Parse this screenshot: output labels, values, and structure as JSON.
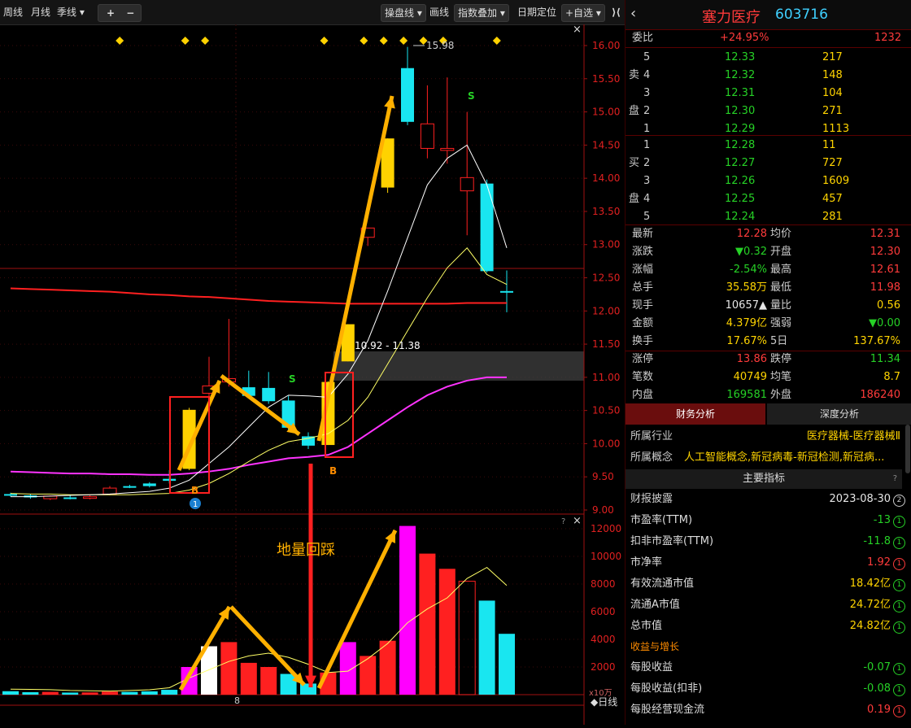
{
  "toolbar": {
    "week": "周线",
    "month": "月线",
    "season": "季线 ▾",
    "plus": "+",
    "minus": "−",
    "mode": "操盘线 ▾",
    "draw": "画线",
    "indicator": "指数叠加 ▾",
    "datepos": "日期定位",
    "watch": "+自选 ▾",
    "collapse": "⟩⟨"
  },
  "stock": {
    "name": "塞力医疗",
    "code": "603716"
  },
  "weibi": {
    "label": "委比",
    "pct": "+24.95%",
    "diff": "1232"
  },
  "sell_label": [
    "卖",
    "盘"
  ],
  "buy_label": [
    "买",
    "盘"
  ],
  "sell": [
    {
      "lvl": "5",
      "price": "12.33",
      "vol": "217"
    },
    {
      "lvl": "4",
      "price": "12.32",
      "vol": "148"
    },
    {
      "lvl": "3",
      "price": "12.31",
      "vol": "104"
    },
    {
      "lvl": "2",
      "price": "12.30",
      "vol": "271"
    },
    {
      "lvl": "1",
      "price": "12.29",
      "vol": "1113"
    }
  ],
  "buy": [
    {
      "lvl": "1",
      "price": "12.28",
      "vol": "11"
    },
    {
      "lvl": "2",
      "price": "12.27",
      "vol": "727"
    },
    {
      "lvl": "3",
      "price": "12.26",
      "vol": "1609"
    },
    {
      "lvl": "4",
      "price": "12.25",
      "vol": "457"
    },
    {
      "lvl": "5",
      "price": "12.24",
      "vol": "281"
    }
  ],
  "quote": [
    {
      "l1": "最新",
      "v1": "12.28",
      "c1": "red",
      "l2": "均价",
      "v2": "12.31",
      "c2": "red"
    },
    {
      "l1": "涨跌",
      "v1": "▼0.32",
      "c1": "grn",
      "l2": "开盘",
      "v2": "12.30",
      "c2": "red"
    },
    {
      "l1": "涨幅",
      "v1": "-2.54%",
      "c1": "grn",
      "l2": "最高",
      "v2": "12.61",
      "c2": "red"
    },
    {
      "l1": "总手",
      "v1": "35.58万",
      "c1": "yel",
      "l2": "最低",
      "v2": "11.98",
      "c2": "red"
    },
    {
      "l1": "现手",
      "v1": "10657▲",
      "c1": "wht",
      "l2": "量比",
      "v2": "0.56",
      "c2": "yel"
    },
    {
      "l1": "金额",
      "v1": "4.379亿",
      "c1": "yel",
      "l2": "强弱",
      "v2": "▼0.00",
      "c2": "grn"
    },
    {
      "l1": "换手",
      "v1": "17.67%",
      "c1": "yel",
      "l2": "5日",
      "v2": "137.67%",
      "c2": "yel"
    },
    {
      "l1": "涨停",
      "v1": "13.86",
      "c1": "red",
      "l2": "跌停",
      "v2": "11.34",
      "c2": "grn"
    },
    {
      "l1": "笔数",
      "v1": "40749",
      "c1": "yel",
      "l2": "均笔",
      "v2": "8.7",
      "c2": "yel"
    },
    {
      "l1": "内盘",
      "v1": "169581",
      "c1": "grn",
      "l2": "外盘",
      "v2": "186240",
      "c2": "red"
    }
  ],
  "tabs": {
    "finance": "财务分析",
    "depth": "深度分析"
  },
  "industry": {
    "label": "所属行业",
    "value": "医疗器械-医疗器械Ⅱ"
  },
  "concept": {
    "label": "所属概念",
    "value": "人工智能概念,新冠病毒-新冠检测,新冠病..."
  },
  "main_title": "主要指标",
  "help": "?",
  "report": {
    "label": "财报披露",
    "value": "2023-08-30",
    "badge": "2"
  },
  "indicators": [
    {
      "label": "市盈率(TTM)",
      "value": "-13",
      "color": "grn",
      "badge": "1"
    },
    {
      "label": "扣非市盈率(TTM)",
      "value": "-11.8",
      "color": "grn",
      "badge": "1"
    },
    {
      "label": "市净率",
      "value": "1.92",
      "color": "red",
      "badge": "1"
    },
    {
      "label": "有效流通市值",
      "value": "18.42亿",
      "color": "yel",
      "badge": "1"
    },
    {
      "label": "流通A市值",
      "value": "24.72亿",
      "color": "yel",
      "badge": "1"
    },
    {
      "label": "总市值",
      "value": "24.82亿",
      "color": "yel",
      "badge": "1"
    }
  ],
  "growth_title": "收益与增长",
  "growth": [
    {
      "label": "每股收益",
      "value": "-0.07",
      "color": "grn",
      "badge": "1"
    },
    {
      "label": "每股收益(扣非)",
      "value": "-0.08",
      "color": "grn",
      "badge": "1"
    },
    {
      "label": "每股经营现金流",
      "value": "0.19",
      "color": "red",
      "badge": "1"
    }
  ],
  "chart_labels": {
    "high": "15.98",
    "range": "10.92 - 11.38",
    "annotation": "地量回踩",
    "date": "8",
    "period": "◆日线",
    "unit": "x10万",
    "sig_s": "S",
    "sig_b": "B",
    "badge1": "1",
    "close_x": "×",
    "question": "?"
  },
  "colors": {
    "up": "#ff2020",
    "down": "#19e6f0",
    "yellow": "#ffd200",
    "magenta": "#ff00ff",
    "arrow": "#ffb000"
  },
  "chart_data": {
    "type": "candlestick",
    "price_ticks": [
      16.0,
      15.5,
      15.0,
      14.5,
      14.0,
      13.5,
      13.0,
      12.5,
      12.0,
      11.5,
      11.0,
      10.5,
      10.0,
      9.5,
      9.0
    ],
    "volume_ticks": [
      12000,
      10000,
      8000,
      6000,
      4000,
      2000
    ],
    "candles": [
      {
        "o": 9.24,
        "h": 9.26,
        "l": 9.2,
        "c": 9.22,
        "col": "down"
      },
      {
        "o": 9.22,
        "h": 9.24,
        "l": 9.17,
        "c": 9.19,
        "col": "down"
      },
      {
        "o": 9.17,
        "h": 9.22,
        "l": 9.15,
        "c": 9.21,
        "col": "up"
      },
      {
        "o": 9.19,
        "h": 9.22,
        "l": 9.16,
        "c": 9.18,
        "col": "down"
      },
      {
        "o": 9.18,
        "h": 9.22,
        "l": 9.16,
        "c": 9.2,
        "col": "up"
      },
      {
        "o": 9.24,
        "h": 9.36,
        "l": 9.22,
        "c": 9.33,
        "col": "up"
      },
      {
        "o": 9.35,
        "h": 9.38,
        "l": 9.33,
        "c": 9.36,
        "col": "down"
      },
      {
        "o": 9.4,
        "h": 9.42,
        "l": 9.34,
        "c": 9.36,
        "col": "down"
      },
      {
        "o": 9.47,
        "h": 9.6,
        "l": 9.4,
        "c": 9.44,
        "col": "down"
      },
      {
        "o": 9.62,
        "h": 10.54,
        "l": 9.6,
        "c": 10.51,
        "col": "yel"
      },
      {
        "o": 10.76,
        "h": 11.31,
        "l": 10.62,
        "c": 10.87,
        "col": "up"
      },
      {
        "o": 10.93,
        "h": 11.88,
        "l": 10.86,
        "c": 10.98,
        "col": "up"
      },
      {
        "o": 10.85,
        "h": 11.1,
        "l": 10.7,
        "c": 10.72,
        "col": "down"
      },
      {
        "o": 10.84,
        "h": 11.08,
        "l": 10.6,
        "c": 10.64,
        "col": "down"
      },
      {
        "o": 10.65,
        "h": 10.72,
        "l": 10.2,
        "c": 10.24,
        "col": "down"
      },
      {
        "o": 10.11,
        "h": 10.17,
        "l": 9.92,
        "c": 9.97,
        "col": "down"
      },
      {
        "o": 9.98,
        "h": 10.94,
        "l": 9.98,
        "c": 10.93,
        "col": "yel"
      },
      {
        "o": 11.24,
        "h": 11.8,
        "l": 11.24,
        "c": 11.8,
        "col": "yel"
      },
      {
        "o": 13.25,
        "h": 13.25,
        "l": 12.98,
        "c": 13.11,
        "col": "up"
      },
      {
        "o": 13.86,
        "h": 14.6,
        "l": 13.78,
        "c": 14.6,
        "col": "yel"
      },
      {
        "o": 14.85,
        "h": 15.98,
        "l": 14.8,
        "c": 15.66,
        "col": "down"
      },
      {
        "o": 14.82,
        "h": 15.4,
        "l": 14.3,
        "c": 14.45,
        "col": "up"
      },
      {
        "o": 14.45,
        "h": 15.52,
        "l": 14.22,
        "c": 14.42,
        "col": "up"
      },
      {
        "o": 14.01,
        "h": 15.0,
        "l": 13.14,
        "c": 13.81,
        "col": "up"
      },
      {
        "o": 13.92,
        "h": 13.98,
        "l": 12.58,
        "c": 12.6,
        "col": "down"
      },
      {
        "o": 12.3,
        "h": 12.61,
        "l": 11.98,
        "c": 12.28,
        "col": "down"
      }
    ],
    "volumes": [
      {
        "v": 250,
        "col": "down"
      },
      {
        "v": 180,
        "col": "down"
      },
      {
        "v": 200,
        "col": "up"
      },
      {
        "v": 150,
        "col": "down"
      },
      {
        "v": 160,
        "col": "up"
      },
      {
        "v": 220,
        "col": "up"
      },
      {
        "v": 200,
        "col": "down"
      },
      {
        "v": 240,
        "col": "down"
      },
      {
        "v": 350,
        "col": "down"
      },
      {
        "v": 2000,
        "col": "magenta"
      },
      {
        "v": 3500,
        "col": "white"
      },
      {
        "v": 3800,
        "col": "up"
      },
      {
        "v": 2300,
        "col": "up"
      },
      {
        "v": 2000,
        "col": "up"
      },
      {
        "v": 1500,
        "col": "down"
      },
      {
        "v": 800,
        "col": "down"
      },
      {
        "v": 1600,
        "col": "up"
      },
      {
        "v": 3800,
        "col": "magenta"
      },
      {
        "v": 2800,
        "col": "up"
      },
      {
        "v": 3900,
        "col": "up"
      },
      {
        "v": 12200,
        "col": "magenta"
      },
      {
        "v": 10200,
        "col": "up"
      },
      {
        "v": 9100,
        "col": "up"
      },
      {
        "v": 8200,
        "col": "hollow"
      },
      {
        "v": 6800,
        "col": "down"
      },
      {
        "v": 4400,
        "col": "down"
      }
    ],
    "ma5": [
      9.2,
      9.2,
      9.21,
      9.22,
      9.23,
      9.24,
      9.26,
      9.28,
      9.33,
      9.45,
      9.7,
      9.95,
      10.25,
      10.55,
      10.73,
      10.72,
      10.7,
      11.05,
      11.55,
      12.3,
      13.1,
      13.9,
      14.3,
      14.5,
      13.9,
      12.95
    ],
    "ma10": [
      9.25,
      9.24,
      9.24,
      9.23,
      9.23,
      9.23,
      9.23,
      9.24,
      9.25,
      9.3,
      9.4,
      9.55,
      9.73,
      9.9,
      10.03,
      10.08,
      10.15,
      10.35,
      10.7,
      11.2,
      11.7,
      12.2,
      12.65,
      12.95,
      12.55,
      12.4
    ],
    "ma_long": [
      12.34,
      12.33,
      12.32,
      12.31,
      12.3,
      12.29,
      12.27,
      12.25,
      12.24,
      12.22,
      12.21,
      12.19,
      12.17,
      12.15,
      12.14,
      12.13,
      12.12,
      12.11,
      12.11,
      12.11,
      12.11,
      12.11,
      12.11,
      12.12,
      12.12,
      12.12
    ],
    "ma_mid": [
      9.58,
      9.57,
      9.56,
      9.55,
      9.55,
      9.54,
      9.54,
      9.53,
      9.53,
      9.55,
      9.58,
      9.62,
      9.68,
      9.73,
      9.78,
      9.8,
      9.83,
      9.95,
      10.15,
      10.35,
      10.55,
      10.73,
      10.86,
      10.95,
      11.0,
      11.0
    ]
  }
}
